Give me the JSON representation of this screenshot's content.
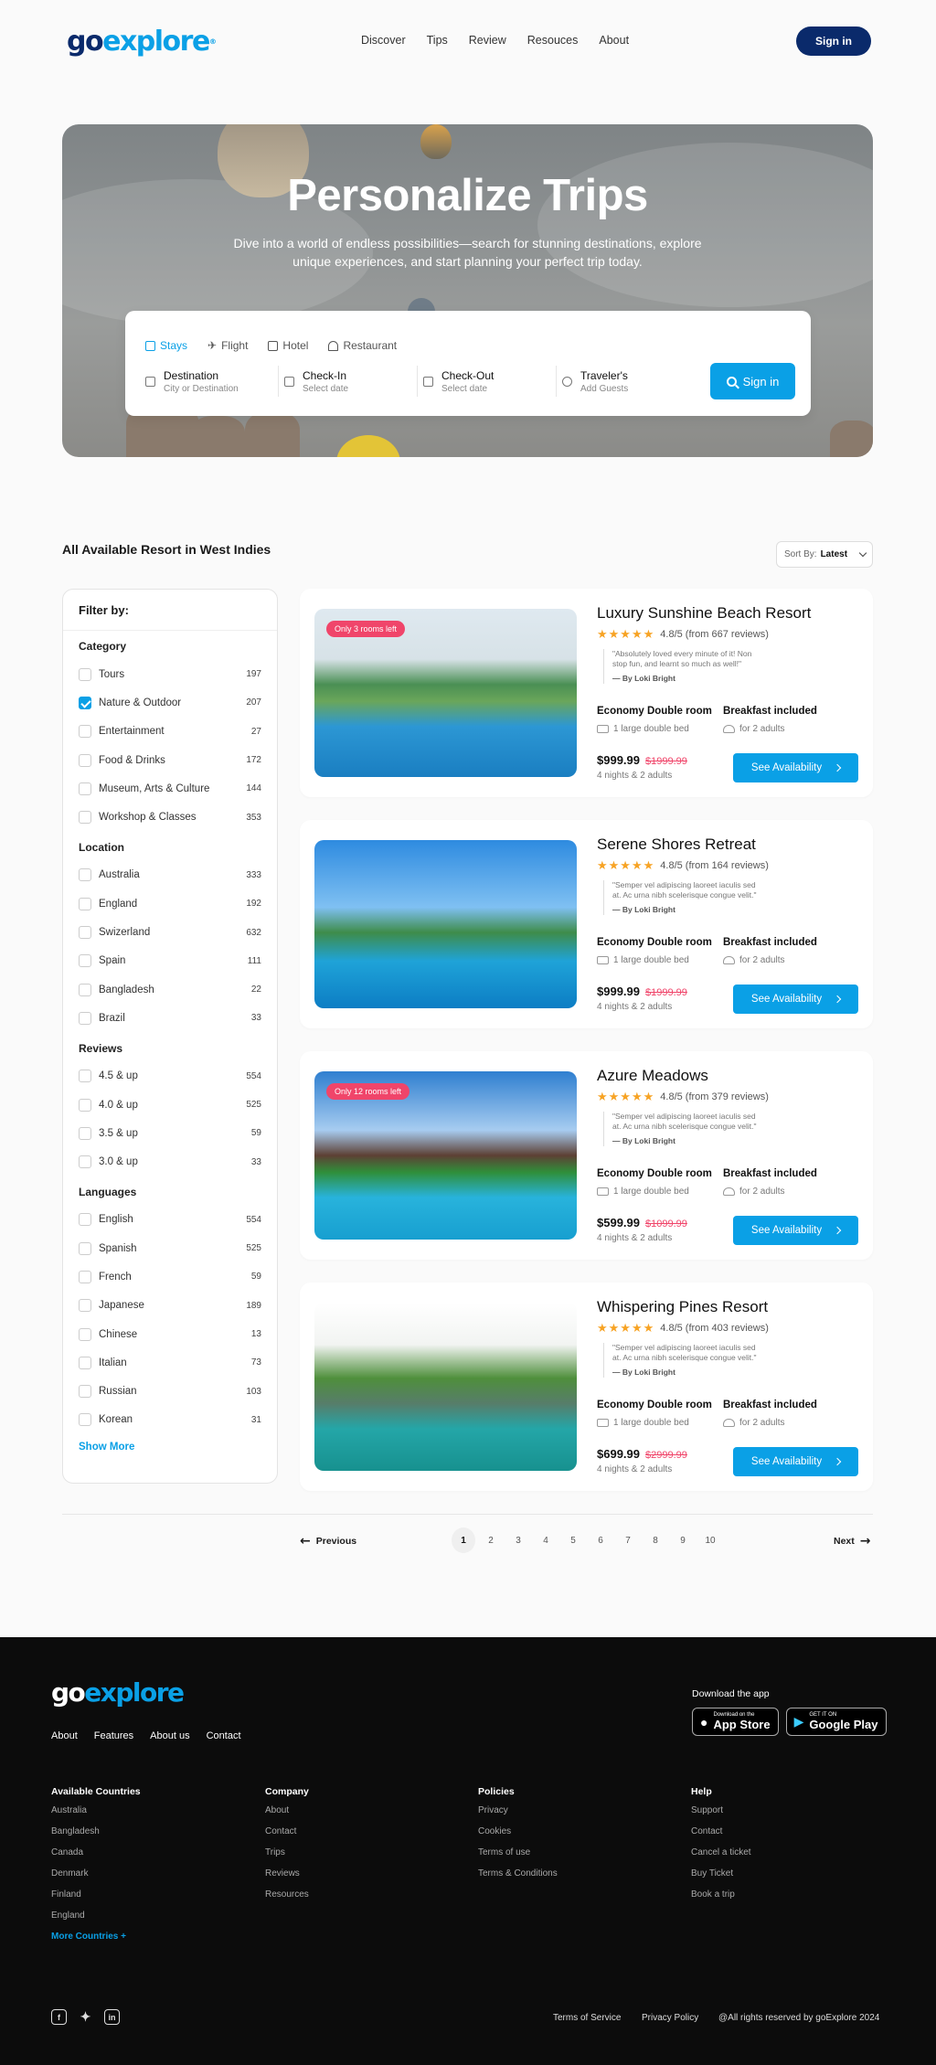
{
  "header": {
    "logo_go": "go",
    "logo_explore": "explore",
    "nav": [
      "Discover",
      "Tips",
      "Review",
      "Resouces",
      "About"
    ],
    "signin": "Sign in"
  },
  "hero": {
    "title": "Personalize Trips",
    "subtitle": "Dive into a world of endless possibilities—search for stunning destinations, explore unique experiences, and start planning your perfect trip today.",
    "tabs": [
      {
        "label": "Stays",
        "icon": "bed-icon",
        "active": true
      },
      {
        "label": "Flight",
        "icon": "plane-icon",
        "active": false
      },
      {
        "label": "Hotel",
        "icon": "building-icon",
        "active": false
      },
      {
        "label": "Restaurant",
        "icon": "cloche-icon",
        "active": false
      }
    ],
    "fields": [
      {
        "title": "Destination",
        "sub": "City or Destination",
        "icon": "bed-icon"
      },
      {
        "title": "Check-In",
        "sub": "Select date",
        "icon": "calendar-icon"
      },
      {
        "title": "Check-Out",
        "sub": "Select date",
        "icon": "calendar-icon"
      },
      {
        "title": "Traveler's",
        "sub": "Add Guests",
        "icon": "user-icon"
      }
    ],
    "search_button": "Sign in"
  },
  "listing": {
    "title": "All Available Resort in West Indies",
    "sort_prefix": "Sort By:",
    "sort_value": "Latest"
  },
  "filter": {
    "title": "Filter by:",
    "groups": [
      {
        "title": "Category",
        "items": [
          {
            "label": "Tours",
            "count": "197",
            "checked": false
          },
          {
            "label": "Nature & Outdoor",
            "count": "207",
            "checked": true
          },
          {
            "label": "Entertainment",
            "count": "27",
            "checked": false
          },
          {
            "label": "Food & Drinks",
            "count": "172",
            "checked": false
          },
          {
            "label": "Museum, Arts & Culture",
            "count": "144",
            "checked": false
          },
          {
            "label": "Workshop & Classes",
            "count": "353",
            "checked": false
          }
        ]
      },
      {
        "title": "Location",
        "items": [
          {
            "label": "Australia",
            "count": "333",
            "checked": false
          },
          {
            "label": "England",
            "count": "192",
            "checked": false
          },
          {
            "label": "Swizerland",
            "count": "632",
            "checked": false
          },
          {
            "label": "Spain",
            "count": "111",
            "checked": false
          },
          {
            "label": "Bangladesh",
            "count": "22",
            "checked": false
          },
          {
            "label": "Brazil",
            "count": "33",
            "checked": false
          }
        ]
      },
      {
        "title": "Reviews",
        "items": [
          {
            "label": "4.5 & up",
            "count": "554",
            "checked": false
          },
          {
            "label": "4.0 & up",
            "count": "525",
            "checked": false
          },
          {
            "label": "3.5 & up",
            "count": "59",
            "checked": false
          },
          {
            "label": "3.0 & up",
            "count": "33",
            "checked": false
          }
        ]
      },
      {
        "title": "Languages",
        "items": [
          {
            "label": "English",
            "count": "554",
            "checked": false
          },
          {
            "label": "Spanish",
            "count": "525",
            "checked": false
          },
          {
            "label": "French",
            "count": "59",
            "checked": false
          },
          {
            "label": "Japanese",
            "count": "189",
            "checked": false
          },
          {
            "label": "Chinese",
            "count": "13",
            "checked": false
          },
          {
            "label": "Italian",
            "count": "73",
            "checked": false
          },
          {
            "label": "Russian",
            "count": "103",
            "checked": false
          },
          {
            "label": "Korean",
            "count": "31",
            "checked": false
          }
        ]
      }
    ],
    "show_more": "Show More"
  },
  "resorts": [
    {
      "name": "Luxury Sunshine Beach Resort",
      "rating": "4.8/5 (from 667 reviews)",
      "badge": "Only 3 rooms left",
      "quote": "\"Absolutely loved every minute of it! Non stop fun, and learnt so much as well!\"",
      "by": "— By Loki Bright",
      "room": "Economy Double room",
      "bed": "1 large double bed",
      "breakfast": "Breakfast included",
      "adults": "for 2 adults",
      "price": "$999.99",
      "old_price": "$1999.99",
      "nights": "4 nights & 2 adults",
      "cta": "See Availability"
    },
    {
      "name": "Serene Shores Retreat",
      "rating": "4.8/5 (from 164 reviews)",
      "badge": "",
      "quote": "\"Semper vel adipiscing laoreet iaculis sed at. Ac urna nibh scelerisque congue velit.\"",
      "by": "— By Loki Bright",
      "room": "Economy Double room",
      "bed": "1 large double bed",
      "breakfast": "Breakfast included",
      "adults": "for 2 adults",
      "price": "$999.99",
      "old_price": "$1999.99",
      "nights": "4 nights & 2 adults",
      "cta": "See Availability"
    },
    {
      "name": "Azure Meadows",
      "rating": "4.8/5 (from 379 reviews)",
      "badge": "Only 12 rooms left",
      "quote": "\"Semper vel adipiscing laoreet iaculis sed at. Ac urna nibh scelerisque congue velit.\"",
      "by": "— By Loki Bright",
      "room": "Economy Double room",
      "bed": "1 large double bed",
      "breakfast": "Breakfast included",
      "adults": "for 2 adults",
      "price": "$599.99",
      "old_price": "$1099.99",
      "nights": "4 nights & 2 adults",
      "cta": "See Availability"
    },
    {
      "name": "Whispering Pines Resort",
      "rating": "4.8/5 (from 403 reviews)",
      "badge": "",
      "quote": "\"Semper vel adipiscing laoreet iaculis sed at. Ac urna nibh scelerisque congue velit.\"",
      "by": "— By Loki Bright",
      "room": "Economy Double room",
      "bed": "1 large double bed",
      "breakfast": "Breakfast included",
      "adults": "for 2 adults",
      "price": "$699.99",
      "old_price": "$2999.99",
      "nights": "4 nights & 2 adults",
      "cta": "See Availability"
    }
  ],
  "pagination": {
    "previous": "Previous",
    "next": "Next",
    "pages": [
      "1",
      "2",
      "3",
      "4",
      "5",
      "6",
      "7",
      "8",
      "9",
      "10"
    ],
    "current": "1"
  },
  "footer": {
    "logo_go": "go",
    "logo_explore": "explore",
    "links": [
      "About",
      "Features",
      "About us",
      "Contact"
    ],
    "download": "Download the app",
    "appstore_small": "Download on the",
    "appstore_big": "App Store",
    "play_small": "GET IT ON",
    "play_big": "Google Play",
    "columns": [
      {
        "title": "Available Countries",
        "items": [
          "Australia",
          "Bangladesh",
          "Canada",
          "Denmark",
          "Finland",
          "England"
        ],
        "more": "More Countries +"
      },
      {
        "title": "Company",
        "items": [
          "About",
          "Contact",
          "Trips",
          "Reviews",
          "Resources"
        ]
      },
      {
        "title": "Policies",
        "items": [
          "Privacy",
          "Cookies",
          "Terms of use",
          "Terms & Conditions"
        ]
      },
      {
        "title": "Help",
        "items": [
          "Support",
          "Contact",
          "Cancel a ticket",
          "Buy Ticket",
          "Book a trip"
        ]
      }
    ],
    "socials": [
      "facebook-icon",
      "twitter-icon",
      "linkedin-icon"
    ],
    "terms": "Terms of Service",
    "privacy": "Privacy Policy",
    "copyright": "@All rights reserved by goExplore 2024"
  },
  "colors": {
    "brand_navy": "#0a2a6b",
    "accent": "#0aa0e6",
    "sale": "#f0456a",
    "star": "#f7a324",
    "footer_bg": "#0c0c0c"
  }
}
